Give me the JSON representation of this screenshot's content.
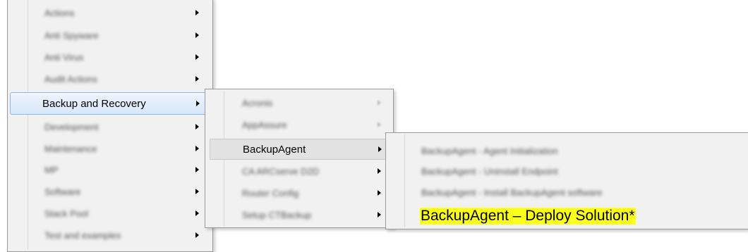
{
  "menu1": {
    "items": [
      {
        "label": "Actions",
        "highlighted": false,
        "has_submenu": true
      },
      {
        "label": "Anti Spyware",
        "highlighted": false,
        "has_submenu": true
      },
      {
        "label": "Anti Virus",
        "highlighted": false,
        "has_submenu": true
      },
      {
        "label": "Audit Actions",
        "highlighted": false,
        "has_submenu": true
      },
      {
        "label": "Backup and Recovery",
        "highlighted": true,
        "has_submenu": true
      },
      {
        "label": "Development",
        "highlighted": false,
        "has_submenu": true
      },
      {
        "label": "Maintenance",
        "highlighted": false,
        "has_submenu": true
      },
      {
        "label": "MP",
        "highlighted": false,
        "has_submenu": true
      },
      {
        "label": "Software",
        "highlighted": false,
        "has_submenu": true
      },
      {
        "label": "Stack Pool",
        "highlighted": false,
        "has_submenu": true
      },
      {
        "label": "Test and examples",
        "highlighted": false,
        "has_submenu": true
      }
    ]
  },
  "menu2": {
    "items": [
      {
        "label": "Acronis",
        "highlighted": false,
        "has_submenu": true
      },
      {
        "label": "AppAssure",
        "highlighted": false,
        "has_submenu": true
      },
      {
        "label": "BackupAgent",
        "highlighted": true,
        "has_submenu": true
      },
      {
        "label": "CA ARCserve D2D",
        "highlighted": false,
        "has_submenu": true
      },
      {
        "label": "Router Config",
        "highlighted": false,
        "has_submenu": true
      },
      {
        "label": "Setup CTBackup",
        "highlighted": false,
        "has_submenu": true
      }
    ]
  },
  "menu3": {
    "items": [
      {
        "label": "BackupAgent - Agent Initialization",
        "highlighted": false
      },
      {
        "label": "BackupAgent - Uninstall Endpoint",
        "highlighted": false
      },
      {
        "label": "BackupAgent - Install BackupAgent software",
        "highlighted": false
      },
      {
        "label": "BackupAgent – Deploy Solution*",
        "highlighted": true
      }
    ]
  },
  "colors": {
    "highlight_yellow": "#fbff1c",
    "selection_blue": "#d7e7fa",
    "menu_bg": "#f1f1f1"
  }
}
